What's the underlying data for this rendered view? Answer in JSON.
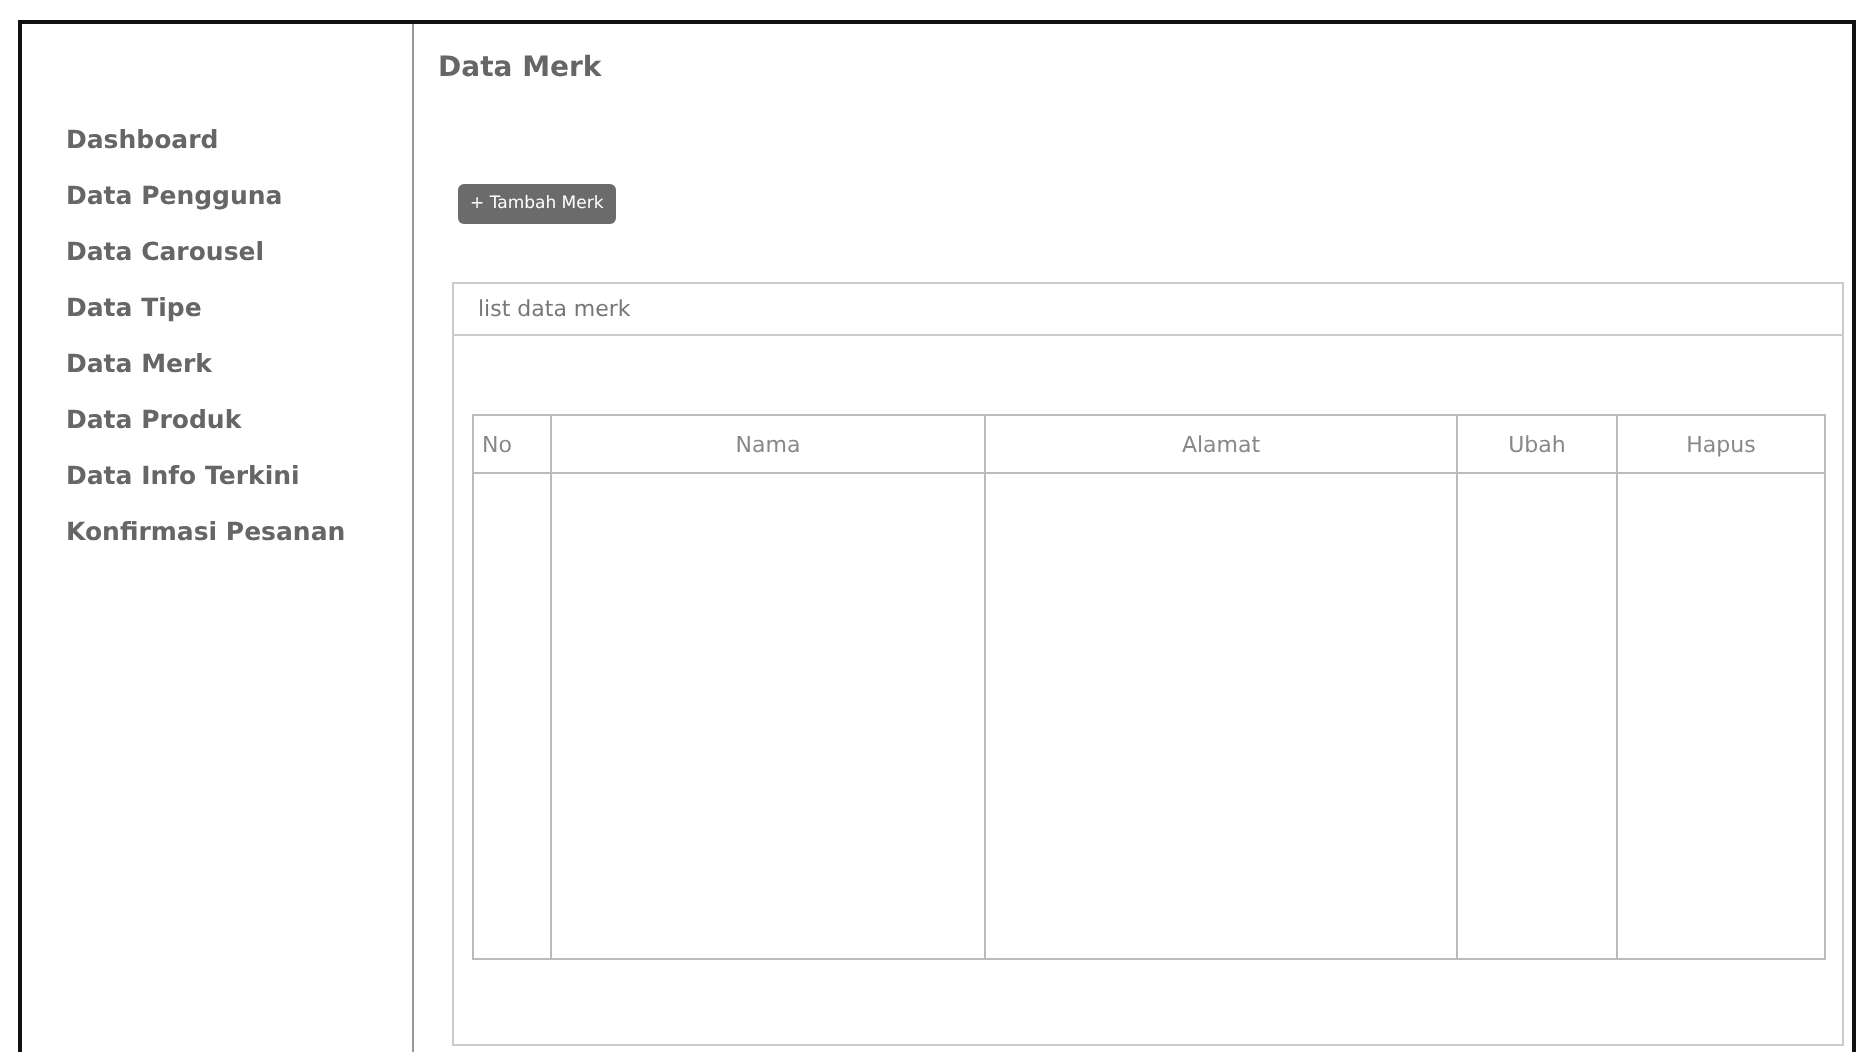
{
  "sidebar": {
    "items": [
      "Dashboard",
      "Data Pengguna",
      "Data Carousel",
      "Data Tipe",
      "Data Merk",
      "Data Produk",
      "Data Info Terkini",
      "Konfirmasi Pesanan"
    ]
  },
  "page_title": "Data Merk",
  "add_button": "+ Tambah Merk",
  "panel": {
    "title": "list data merk",
    "table": {
      "columns": [
        "No",
        "Nama",
        "Alamat",
        "Ubah",
        "Hapus"
      ]
    }
  }
}
